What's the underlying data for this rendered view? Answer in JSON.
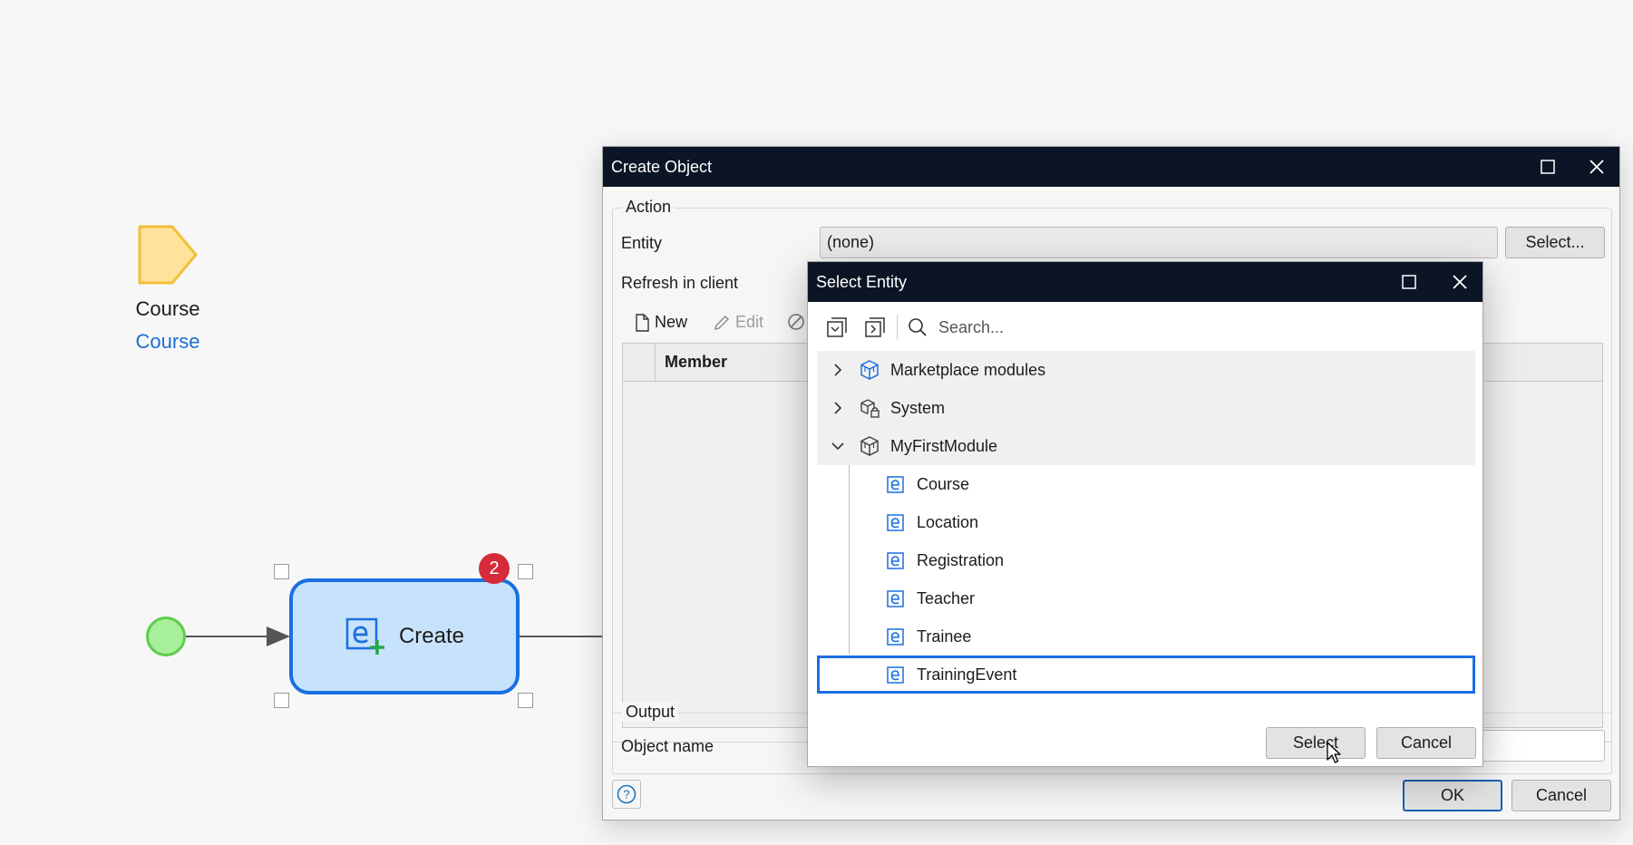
{
  "canvas": {
    "parameter": {
      "name": "Course",
      "type": "Course"
    },
    "activity": {
      "label": "Create",
      "badge": "2"
    }
  },
  "create_object": {
    "title": "Create Object",
    "action_group": {
      "legend": "Action",
      "entity_label": "Entity",
      "entity_value": "(none)",
      "select_button": "Select...",
      "refresh_label": "Refresh in client"
    },
    "toolbar": {
      "new": "New",
      "edit": "Edit"
    },
    "grid": {
      "columns": [
        "Member"
      ]
    },
    "output_group": {
      "legend": "Output",
      "object_name_label": "Object name",
      "object_name_value": ""
    },
    "buttons": {
      "ok": "OK",
      "cancel": "Cancel"
    }
  },
  "select_entity": {
    "title": "Select Entity",
    "search_placeholder": "Search...",
    "modules": [
      {
        "label": "Marketplace modules",
        "expanded": false,
        "icon": "marketplace-module-icon"
      },
      {
        "label": "System",
        "expanded": false,
        "icon": "system-module-icon"
      },
      {
        "label": "MyFirstModule",
        "expanded": true,
        "icon": "module-icon"
      }
    ],
    "entities": [
      "Course",
      "Location",
      "Registration",
      "Teacher",
      "Trainee",
      "TrainingEvent"
    ],
    "selected_entity": "TrainingEvent",
    "buttons": {
      "select": "Select",
      "cancel": "Cancel"
    }
  },
  "colors": {
    "titlebar": "#0c1525",
    "accent": "#1a6fe0",
    "activity_fill": "#c7e2fb",
    "badge": "#d62b3b",
    "start_event": "#a7ef9b",
    "parameter": "#ffe39a"
  }
}
